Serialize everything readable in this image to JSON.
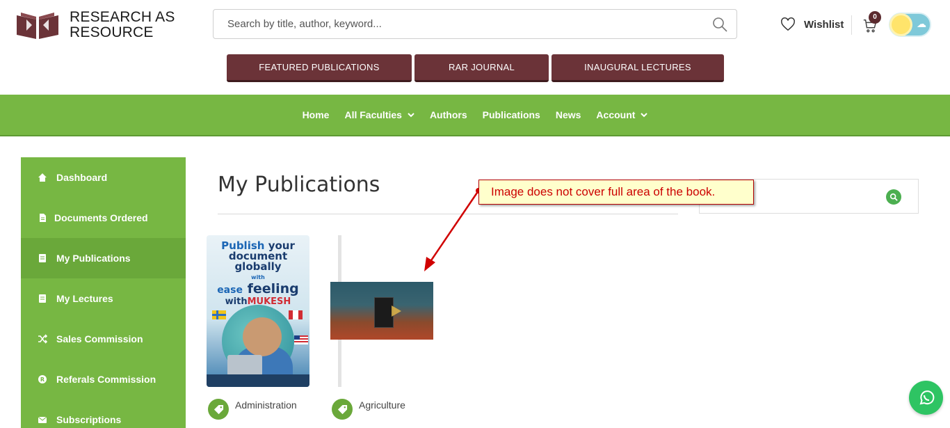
{
  "brand": {
    "line1": "RESEARCH AS",
    "line2": "RESOURCE",
    "color": "#6b3338"
  },
  "search": {
    "placeholder": "Search by title, author, keyword..."
  },
  "header": {
    "wishlist_label": "Wishlist",
    "cart_count": "0"
  },
  "pub_buttons": [
    "FEATURED PUBLICATIONS",
    "RAR JOURNAL",
    "INAUGURAL LECTURES"
  ],
  "nav": {
    "items": [
      {
        "label": "Home"
      },
      {
        "label": "All Faculties"
      },
      {
        "label": "Authors"
      },
      {
        "label": "Publications"
      },
      {
        "label": "News"
      },
      {
        "label": "Account"
      }
    ],
    "color": "#77b743"
  },
  "sidebar": {
    "items": [
      {
        "label": "Dashboard"
      },
      {
        "label": "Documents Ordered"
      },
      {
        "label": "My Publications"
      },
      {
        "label": "My Lectures"
      },
      {
        "label": "Sales Commission"
      },
      {
        "label": "Referals Commission"
      },
      {
        "label": "Subscriptions"
      }
    ],
    "active": "My Publications"
  },
  "main": {
    "title": "My Publications",
    "books": [
      {
        "category": "Administration",
        "cover_text": {
          "l1a": "Publish",
          "l1b": "your",
          "l2": "document",
          "l3": "globally",
          "l4": "with",
          "l5a": "ease",
          "l5b": "feeling",
          "l6a": "with",
          "l6b": "MUKESH"
        }
      },
      {
        "category": "Agriculture"
      }
    ]
  },
  "annotation": {
    "text": "Image does not cover full area of the book."
  }
}
